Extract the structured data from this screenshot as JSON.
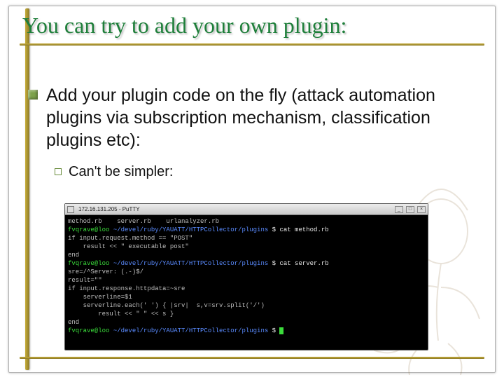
{
  "title": "You can try to add your own plugin:",
  "bullet1": "Add your plugin code on the fly (attack automation plugins via subscription mechanism, classification plugins etc):",
  "bullet2": "Can't be simpler:",
  "terminal": {
    "window_title": "172.16.131.205 - PuTTY",
    "lines": {
      "l1": "method.rb    server.rb    urlanalyzer.rb",
      "p1_user": "fvqrave@loo ",
      "p1_path": "~/devel/ruby/YAUATT/HTTPCollector/plugins",
      "p1_cmd": " $ cat method.rb",
      "l2": "if input.request.method == \"POST\"",
      "l3": "    result << \" executable post\"",
      "l4": "end",
      "p2_user": "fvqrave@loo ",
      "p2_path": "~/devel/ruby/YAUATT/HTTPCollector/plugins",
      "p2_cmd": " $ cat server.rb",
      "l5": "sre=/^Server: (.-)$/",
      "l6": "result=\"\"",
      "l7": "if input.response.httpdata=~sre",
      "l8": "    serverline=$1",
      "l9": "    serverline.each(' ') { |srv|  s,v=srv.split('/')",
      "l10": "        result << \" \" << s }",
      "l11": "end",
      "p3_user": "fvqrave@loo ",
      "p3_path": "~/devel/ruby/YAUATT/HTTPCollector/plugins",
      "p3_tail": " $ "
    }
  }
}
